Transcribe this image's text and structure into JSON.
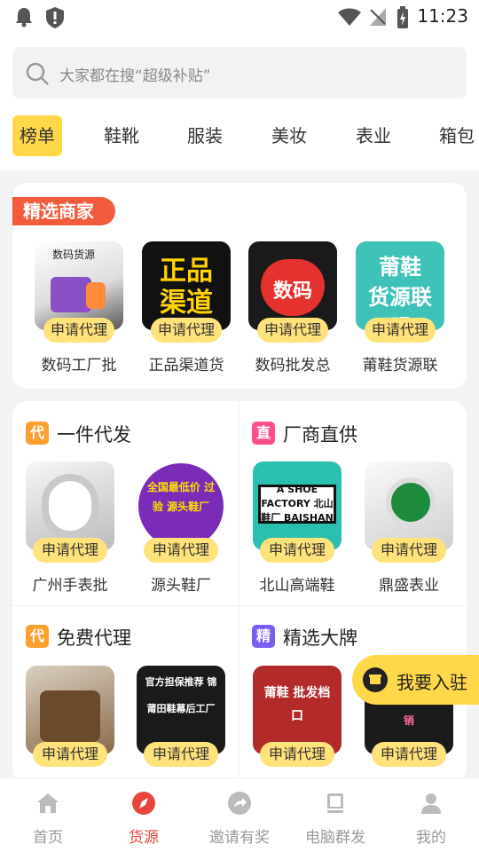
{
  "status_bar": {
    "time": "11:23"
  },
  "search": {
    "placeholder": "大家都在搜“超级补贴”"
  },
  "tabs": [
    "榜单",
    "鞋靴",
    "服装",
    "美妆",
    "表业",
    "箱包"
  ],
  "featured": {
    "title": "精选商家",
    "apply_label": "申请代理",
    "merchants": [
      {
        "name": "数码工厂批",
        "thumb_text": "数码货源"
      },
      {
        "name": "正品渠道货",
        "thumb_text": "正品\n渠道货"
      },
      {
        "name": "数码批发总",
        "thumb_text": "数码"
      },
      {
        "name": "莆鞋货源联",
        "thumb_text": "莆鞋\n货源联盟"
      }
    ]
  },
  "sections": [
    {
      "icon": "代",
      "title": "一件代发",
      "items": [
        "广州手表批",
        "源头鞋厂"
      ],
      "thumbs": [
        "",
        "全国最低价 过 验 源头鞋厂"
      ]
    },
    {
      "icon": "直",
      "title": "厂商直供",
      "items": [
        "北山高端鞋",
        "鼎盛表业"
      ],
      "thumbs": [
        "A SHOE FACTORY 北山鞋厂 BAISHAN",
        ""
      ]
    },
    {
      "icon": "代",
      "title": "免费代理",
      "items": [],
      "thumbs": [
        "",
        "官方担保推荐 锦 莆田鞋幕后工厂"
      ]
    },
    {
      "icon": "精",
      "title": "精选大牌",
      "items": [],
      "thumbs": [
        "莆鞋 批发档口",
        "AG 莆田工厂直销"
      ]
    }
  ],
  "join_button": {
    "label": "我要入驻"
  },
  "bottom_nav": [
    {
      "label": "首页",
      "icon": "home-icon"
    },
    {
      "label": "货源",
      "icon": "compass-icon"
    },
    {
      "label": "邀请有奖",
      "icon": "share-icon"
    },
    {
      "label": "电脑群发",
      "icon": "book-icon"
    },
    {
      "label": "我的",
      "icon": "person-icon"
    }
  ],
  "colors": {
    "accent": "#ffd84a",
    "ribbon": "#f25c3c",
    "active_nav": "#e8453c"
  }
}
